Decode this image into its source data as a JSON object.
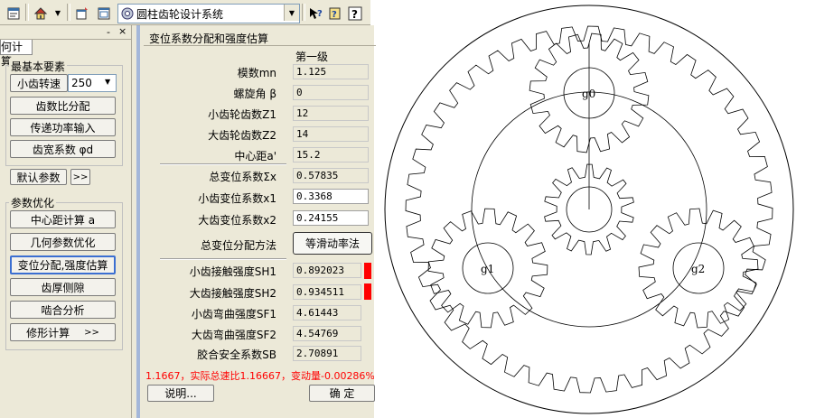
{
  "toolbar": {
    "app_combo_text": "圆柱齿轮设计系统",
    "icons": [
      "properties-icon",
      "home-icon",
      "dropdown-arrow-icon",
      "new-window-icon",
      "window-list-icon",
      "gear-app-icon",
      "combo-dropdown-icon",
      "whats-this-icon",
      "help-book-icon",
      "help-question-icon"
    ]
  },
  "left": {
    "pin_glyph": "-",
    "close_glyph": "×",
    "tab_label": "何计算",
    "group_basic": "最基本要素",
    "speed_button": "小齿转速",
    "speed_value": "250",
    "ratio_button": "齿数比分配",
    "power_button": "传递功率输入",
    "width_button": "齿宽系数 φd",
    "default_button": "默认参数",
    "more_button": ">>",
    "group_opt": "参数优化",
    "center_button": "中心距计算 a",
    "geom_button": "几何参数优化",
    "shift_button": "变位分配,强度估算",
    "tooth_button": "齿厚侧隙",
    "mesh_button": "啮合分析",
    "modify_button": "修形计算",
    "modify_more": ">>"
  },
  "dialog": {
    "title": "变位系数分配和强度估算",
    "stage_header": "第一级",
    "rows": [
      {
        "label": "模数mn",
        "value": "1.125"
      },
      {
        "label": "螺旋角 β",
        "value": "0"
      },
      {
        "label": "小齿轮齿数Z1",
        "value": "12"
      },
      {
        "label": "大齿轮齿数Z2",
        "value": "14"
      },
      {
        "label": "中心距a'",
        "value": "15.2"
      },
      {
        "label": "总变位系数Σx",
        "value": "0.57835"
      },
      {
        "label": "小齿变位系数x1",
        "value": "0.3368"
      },
      {
        "label": "大齿变位系数x2",
        "value": "0.24155"
      }
    ],
    "method_label": "总变位分配方法",
    "method_button": "等滑动率法",
    "strength_rows": [
      {
        "label": "小齿接触强度SH1",
        "value": "0.892023"
      },
      {
        "label": "大齿接触强度SH2",
        "value": "0.934511"
      },
      {
        "label": "小齿弯曲强度SF1",
        "value": "4.61443"
      },
      {
        "label": "大齿弯曲强度SF2",
        "value": "4.54769"
      },
      {
        "label": "胶合安全系数SB",
        "value": "2.70891"
      }
    ],
    "status_text": "1.1667，实际总速比1.16667，变动量-0.00286%",
    "status_color": "#ff0000",
    "help_button": "说明...",
    "ok_button": "确  定"
  },
  "drawing": {
    "planet_labels": [
      "g0",
      "g1",
      "g2"
    ]
  }
}
